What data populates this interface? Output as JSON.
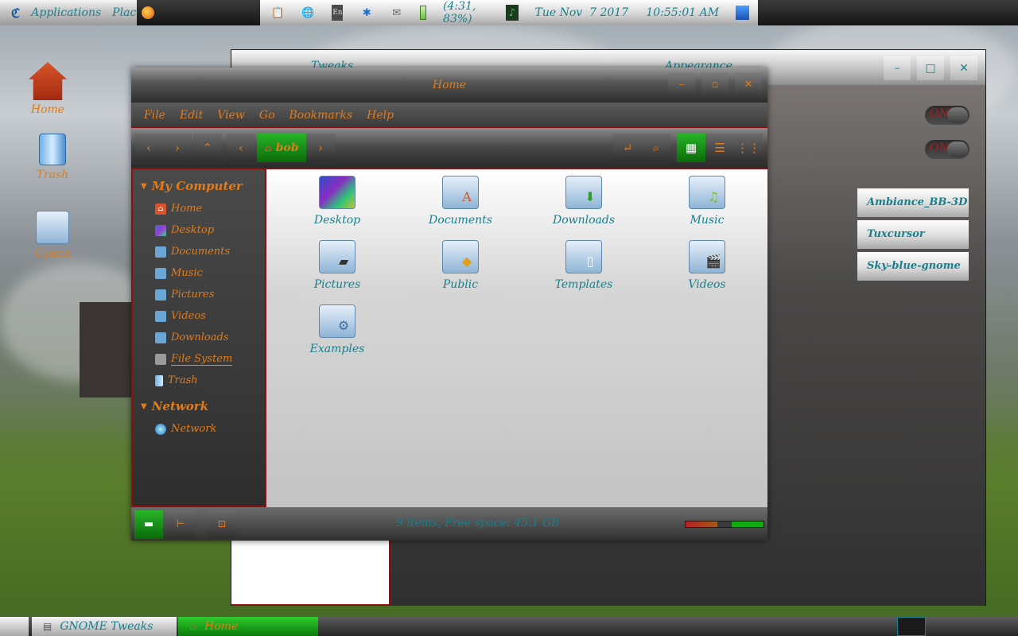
{
  "top_panel": {
    "applications": "Applications",
    "places": "Places",
    "battery": "(4:31, 83%)",
    "datetime": "Tue Nov  7 2017     10:55:01 AM",
    "lang": "En"
  },
  "desktop": {
    "icons": [
      {
        "label": "Home"
      },
      {
        "label": "Trash"
      },
      {
        "label": "Cyana"
      }
    ]
  },
  "tweaks_window": {
    "title": "Tweaks",
    "section": "Appearance",
    "switch1": "ON",
    "switch2": "ON",
    "themes": [
      "Ambiance_BB-3D",
      "Tuxcursor",
      "Sky-blue-gnome"
    ]
  },
  "nautilus": {
    "title": "Home",
    "menu": [
      "File",
      "Edit",
      "View",
      "Go",
      "Bookmarks",
      "Help"
    ],
    "breadcrumb": "bob",
    "sidebar": {
      "my_computer": "My Computer",
      "computer_items": [
        "Home",
        "Desktop",
        "Documents",
        "Music",
        "Pictures",
        "Videos",
        "Downloads",
        "File System",
        "Trash"
      ],
      "network_head": "Network",
      "network_items": [
        "Network"
      ]
    },
    "files": [
      "Desktop",
      "Documents",
      "Downloads",
      "Music",
      "Pictures",
      "Public",
      "Templates",
      "Videos",
      "Examples"
    ],
    "status": "9 items, Free space: 45.1 GB"
  },
  "taskbar": {
    "tasks": [
      "GNOME Tweaks",
      "Home"
    ]
  },
  "colors": {
    "accent_orange": "#e07c1a",
    "accent_teal": "#17808d",
    "active_green": "#11aa11",
    "border_red": "#8d1010"
  }
}
